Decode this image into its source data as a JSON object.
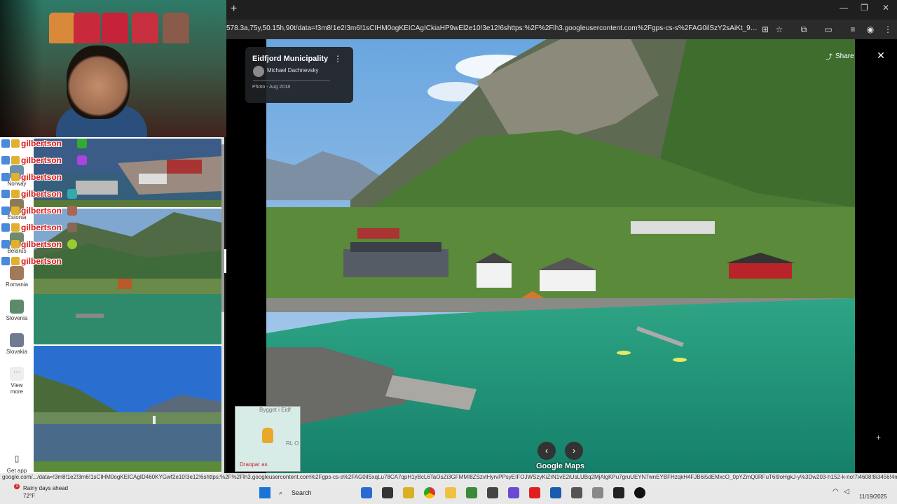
{
  "browser": {
    "new_tab_label": "+",
    "url": "578.3a,75y,50.15h,90t/data=!3m8!1e2!3m6!1sCIHM0ogKEICAgICkiaHP9wEl2e10!3e12!6shttps:%2F%2Flh3.googleusercontent.com%2Fgps-cs-s%2FAG0ilSzY2sAiKt_9yem5aG5-2VfA...",
    "window_controls": [
      "—",
      "❐",
      "✕"
    ]
  },
  "chat": {
    "username": "gilbertson",
    "lines": 8
  },
  "sidebar": {
    "items": [
      {
        "label": "Norway",
        "color": "#6a90b0"
      },
      {
        "label": "Estonia",
        "color": "#8a7a5a"
      },
      {
        "label": "Belarus",
        "color": "#6d8a6d"
      },
      {
        "label": "Romania",
        "color": "#a07a5a"
      },
      {
        "label": "Slovenia",
        "color": "#5d8a6a"
      },
      {
        "label": "Slovakia",
        "color": "#707a90"
      },
      {
        "label": "View more",
        "icon": "more-dots-icon"
      },
      {
        "label": "Get app",
        "icon": "phone-icon"
      }
    ]
  },
  "photo_info": {
    "place": "Eidfjord Municipality",
    "author": "Michael Dachnevsky",
    "date": "Photo - Aug 2018"
  },
  "viewer": {
    "share_label": "Share",
    "close_label": "✕",
    "prev_label": "‹",
    "next_label": "›",
    "brand": "Google Maps"
  },
  "minimap": {
    "label_top": "Bygget i Eidf",
    "label_right": "RL O",
    "place": "Draopar as"
  },
  "status_url": "google.com/.../data=!3m8!1e2!3m6!1sCIHM0ogKEICAgID460KYGwf2e10!3e12!6shttps:%2F%2Flh3.googleusercontent.com%2Fgps-cs-s%2FAG0ilSxqLu78CA7qpH1yBcL6TaOsZi3GFMMI8ZSzvlHyrvPPsyEIFOJWSzyKiZrN1vE2iUsLUBq2MjAlgKPu7gruUEYN7wnEYBFHzqkH4FJB6i5dEMxcO_0pYZmQ0RFuT6i9oHgkJ-y%3Dw203-h152-k-no!7i4608!8i3456!4m7!1m...",
  "taskbar": {
    "weather_text": "Rainy days ahead",
    "weather_sub": "72°F",
    "notif_count": "3",
    "search_label": "Search",
    "time": "11/19/2025"
  }
}
